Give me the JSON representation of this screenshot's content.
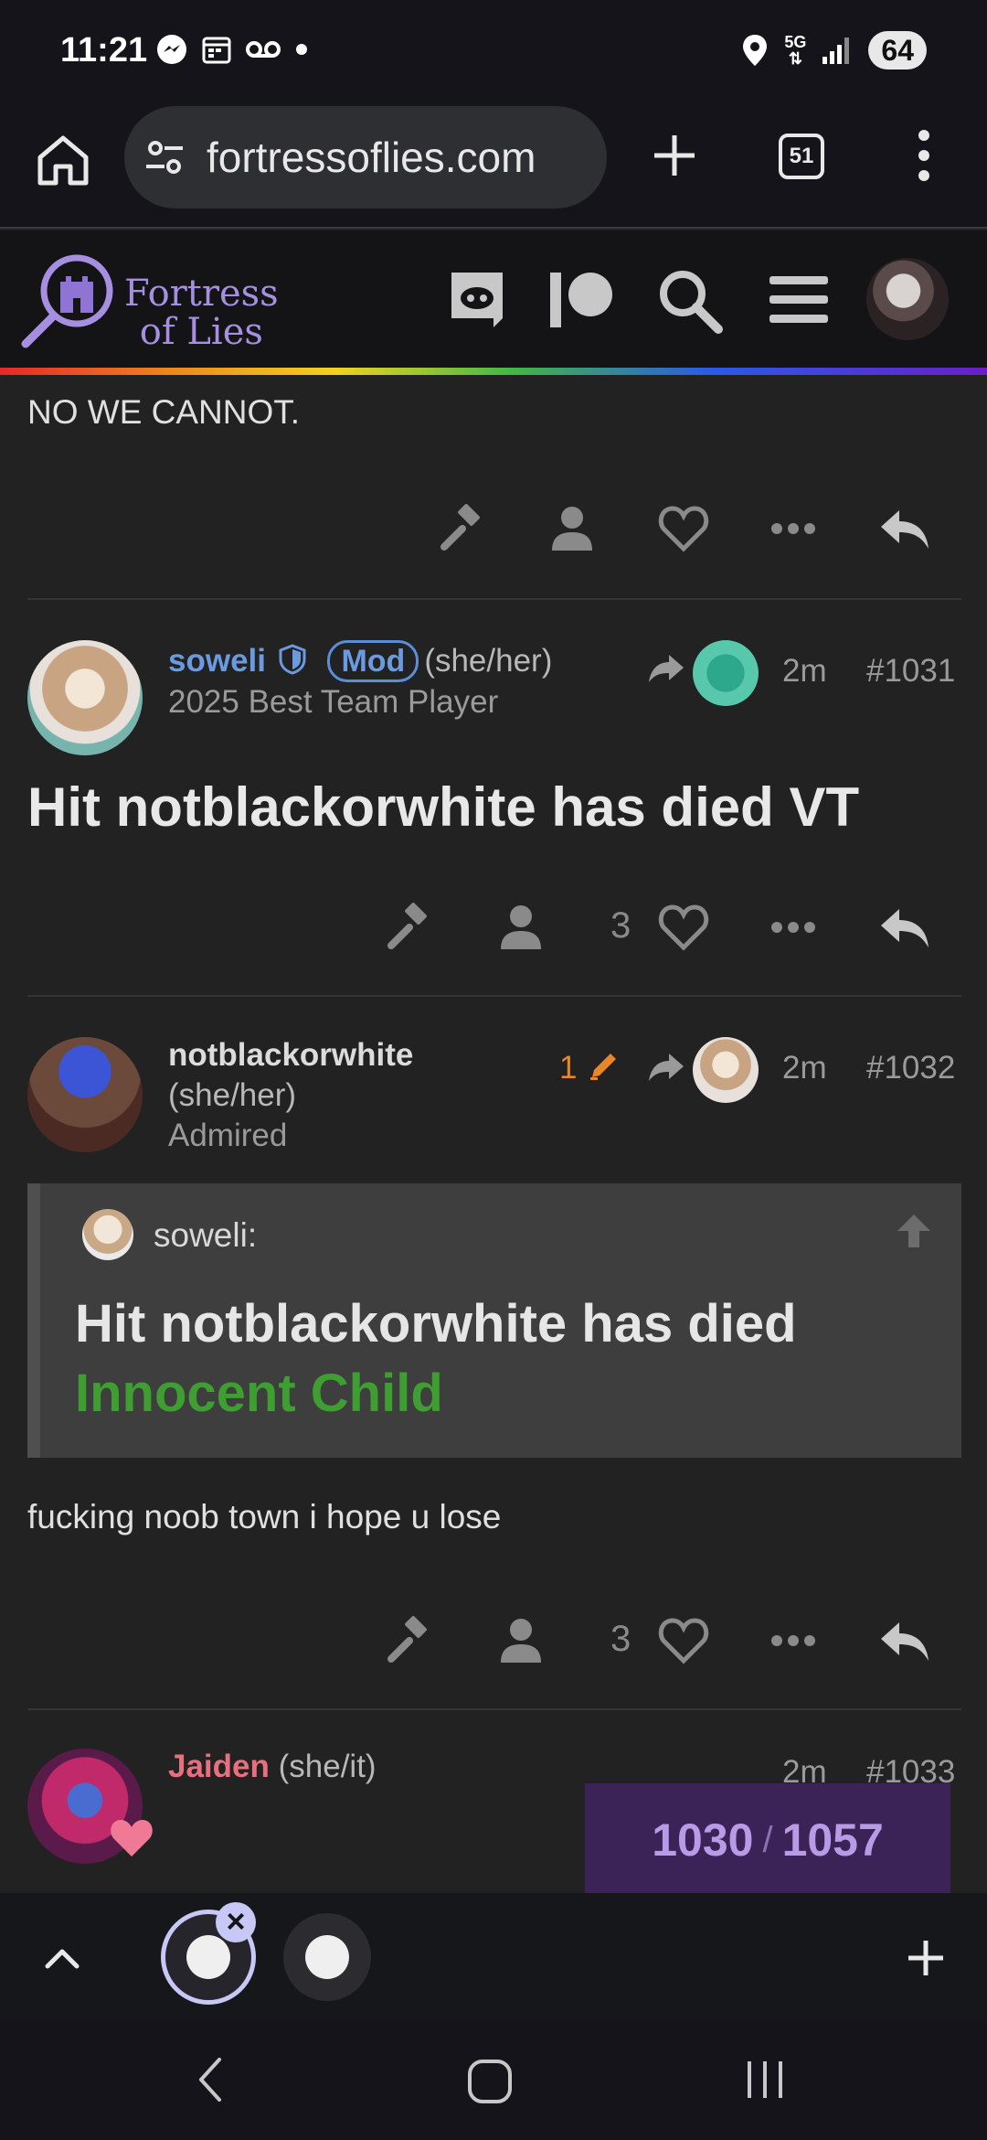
{
  "status_bar": {
    "time": "11:21",
    "network": "5G",
    "battery": "64"
  },
  "browser": {
    "url": "fortressoflies.com",
    "tab_count": "51"
  },
  "site": {
    "logo_line1": "Fortress",
    "logo_line2": "of Lies",
    "accent": "#a68fe0"
  },
  "posts": {
    "prev_text": "NO WE CANNOT.",
    "post1031": {
      "username": "soweli",
      "mod_badge": "Mod",
      "pronouns": "(she/her)",
      "title": "2025 Best Team Player",
      "time": "2m",
      "number": "#1031",
      "body": "Hit notblackorwhite has died VT",
      "likes": "3"
    },
    "post1032": {
      "username": "notblackorwhite",
      "pronouns": "(she/her)",
      "title": "Admired",
      "edits": "1",
      "time": "2m",
      "number": "#1032",
      "quote_author": "soweli:",
      "quote_line1": "Hit notblackorwhite has died",
      "quote_line2": "Innocent Child",
      "body": "fucking noob town i hope u lose",
      "likes": "3"
    },
    "post1033": {
      "username": "Jaiden",
      "pronouns": "(she/it)",
      "time": "2m",
      "number": "#1033"
    }
  },
  "progress": {
    "current": "1030",
    "separator": "/",
    "total": "1057"
  },
  "colors": {
    "username_default": "#dcdcdc",
    "username_soweli": "#6b9ae0",
    "username_jaiden": "#e8707e",
    "edit_orange": "#e8862a",
    "innocent_green": "#3f9e32"
  }
}
